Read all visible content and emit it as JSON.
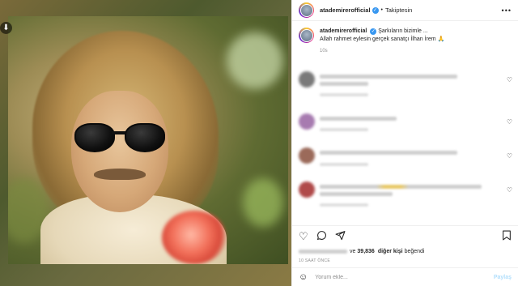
{
  "header": {
    "username": "atademirerofficial",
    "verified_mark": "✓",
    "separator": "•",
    "follow_label": "Takiptesin",
    "more_icon": "more-horizontal-icon",
    "more_glyph": "•••"
  },
  "caption": {
    "username": "atademirerofficial",
    "line1": "Şarkıların bizimle ...",
    "line2": "Allah rahmet eylesin gerçek sanatçı İlhan İrem",
    "emoji": "🙏",
    "time": "10s"
  },
  "comments": [
    {
      "avatar_color": "#7a7a7a",
      "lines": 2,
      "has_icon": true
    },
    {
      "avatar_color": "#a77bb0",
      "lines": 1,
      "has_icon": false
    },
    {
      "avatar_color": "#9b6a5a",
      "lines": 2,
      "has_icon": false
    },
    {
      "avatar_color": "#b04a4a",
      "lines": 2,
      "has_icon": true
    }
  ],
  "actions": {
    "like_icon": "heart-icon",
    "comment_icon": "comment-icon",
    "share_icon": "share-icon",
    "save_icon": "bookmark-icon"
  },
  "likes": {
    "connector": "ve",
    "count": "39,836",
    "suffix_bold": "diğer kişi",
    "suffix": "beğendi"
  },
  "post_time": "10 SAAT ÖNCE",
  "add_comment": {
    "emoji_icon": "smiley-icon",
    "placeholder": "Yorum ekle...",
    "share_label": "Paylaş"
  },
  "colors": {
    "accent_blue": "#3897f0",
    "text": "#262626",
    "muted": "#8e8e8e",
    "border": "#efefef"
  }
}
